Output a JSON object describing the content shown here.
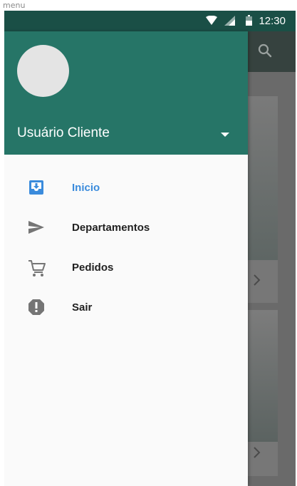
{
  "window": {
    "title": "menu"
  },
  "status_bar": {
    "time": "12:30",
    "icons": [
      "wifi-icon",
      "signal-icon",
      "battery-icon"
    ]
  },
  "app_bar": {
    "search_icon": "search-icon"
  },
  "drawer": {
    "account_name": "Usuário Cliente",
    "header_color": "#267567",
    "items": [
      {
        "label": "Inicio",
        "icon": "inbox-download-icon",
        "active": true
      },
      {
        "label": "Departamentos",
        "icon": "send-icon",
        "active": false
      },
      {
        "label": "Pedidos",
        "icon": "cart-icon",
        "active": false
      },
      {
        "label": "Sair",
        "icon": "alert-octagon-icon",
        "active": false
      }
    ]
  },
  "colors": {
    "accent": "#3a8bdc",
    "status_bar": "#1a4f46",
    "icon_grey": "#757575"
  }
}
